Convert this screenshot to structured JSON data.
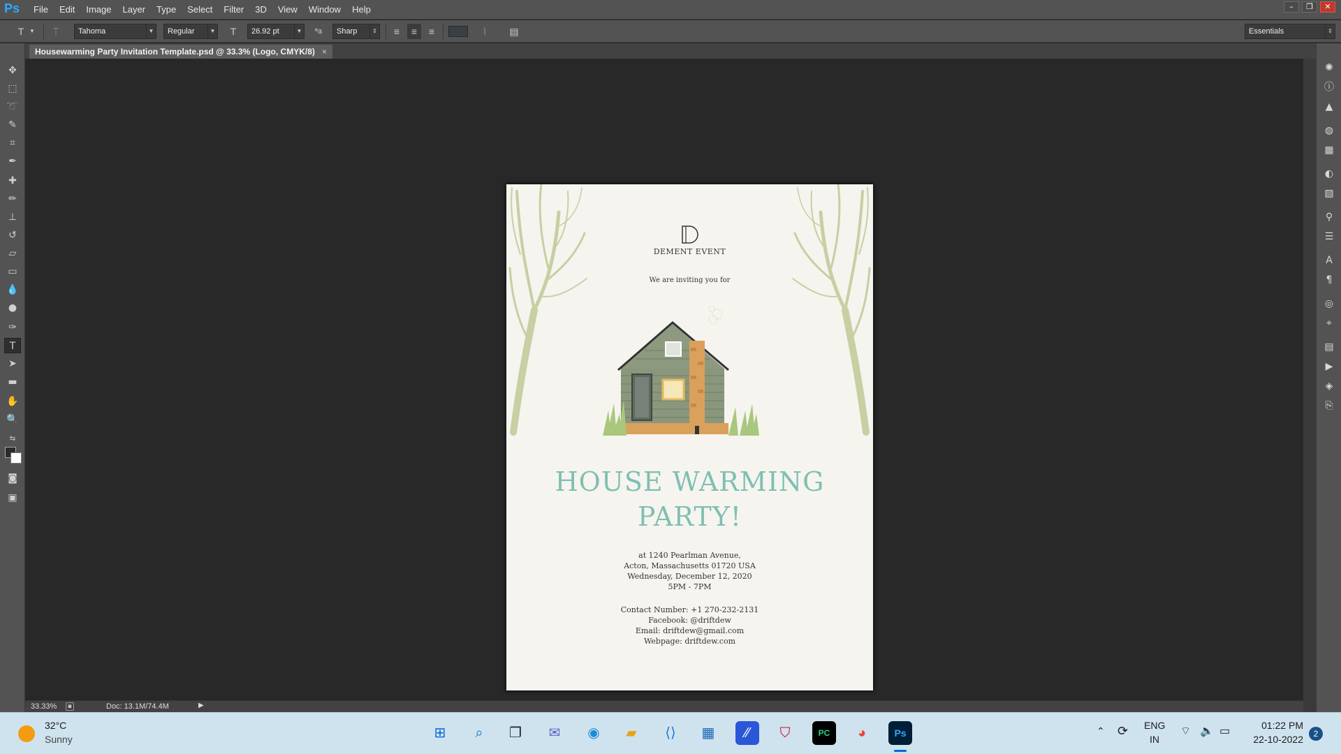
{
  "app": {
    "logo": "Ps",
    "menu": [
      "File",
      "Edit",
      "Image",
      "Layer",
      "Type",
      "Select",
      "Filter",
      "3D",
      "View",
      "Window",
      "Help"
    ],
    "window_controls": [
      "–",
      "❐",
      "✕"
    ]
  },
  "options": {
    "font_family": "Tahoma",
    "font_style": "Regular",
    "font_size": "26.92 pt",
    "antialias": "Sharp",
    "workspace": "Essentials"
  },
  "document_tab": {
    "title": "Housewarming Party Invitation Template.psd @ 33.3% (Logo, CMYK/8)",
    "close": "×"
  },
  "invitation": {
    "brand": "DEMENT EVENT",
    "brand_mark": "D",
    "intro": "We are inviting you for",
    "headline_1": "HOUSE WARMING",
    "headline_2": "PARTY!",
    "address_1": "at 1240  Pearlman Avenue,",
    "address_2": "Acton, Massachusetts 01720 USA",
    "date": "Wednesday, December 12, 2020",
    "time": "5PM - 7PM",
    "contact": "Contact Number: +1 270-232-2131",
    "facebook": "Facebook: @driftdew",
    "email": "Email:  driftdew@gmail.com",
    "webpage": "Webpage: driftdew.com",
    "colors": {
      "headline": "#7fbfb3",
      "paper": "#f6f4ee",
      "tree": "#c7cfa3",
      "house": "#8e9a7f",
      "brick": "#d9a15b"
    }
  },
  "status": {
    "zoom": "33.33%",
    "doc": "Doc: 13.1M/74.4M"
  },
  "taskbar": {
    "weather_temp": "32°C",
    "weather_text": "Sunny",
    "lang_1": "ENG",
    "lang_2": "IN",
    "time": "01:22 PM",
    "date": "22-10-2022",
    "notifications": "2"
  }
}
